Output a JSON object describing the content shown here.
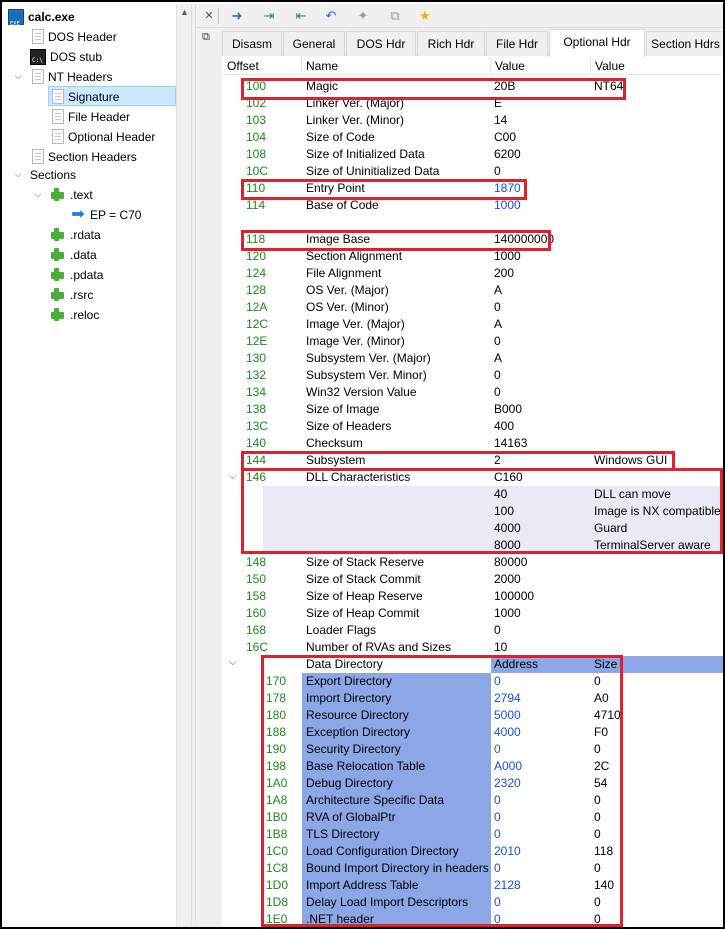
{
  "tree": {
    "root": "calc.exe",
    "items": [
      "DOS Header",
      "DOS stub",
      "NT Headers",
      "Signature",
      "File Header",
      "Optional Header",
      "Section Headers",
      "Sections",
      ".text",
      "EP = C70",
      ".rdata",
      ".data",
      ".pdata",
      ".rsrc",
      ".reloc"
    ]
  },
  "tabs": [
    "Disasm",
    "General",
    "DOS Hdr",
    "Rich Hdr",
    "File Hdr",
    "Optional Hdr",
    "Section Hdrs"
  ],
  "columns": {
    "offset": "Offset",
    "name": "Name",
    "value": "Value",
    "desc": "Value"
  },
  "rows": [
    {
      "off": "100",
      "name": "Magic",
      "val": "20B",
      "desc": "NT64"
    },
    {
      "off": "102",
      "name": "Linker Ver. (Major)",
      "val": "E",
      "desc": ""
    },
    {
      "off": "103",
      "name": "Linker Ver. (Minor)",
      "val": "14",
      "desc": ""
    },
    {
      "off": "104",
      "name": "Size of Code",
      "val": "C00",
      "desc": ""
    },
    {
      "off": "108",
      "name": "Size of Initialized Data",
      "val": "6200",
      "desc": ""
    },
    {
      "off": "10C",
      "name": "Size of Uninitialized Data",
      "val": "0",
      "desc": ""
    },
    {
      "off": "110",
      "name": "Entry Point",
      "val": "1870",
      "desc": ""
    },
    {
      "off": "114",
      "name": "Base of Code",
      "val": "1000",
      "desc": ""
    },
    {
      "off": "",
      "name": "",
      "val": "",
      "desc": ""
    },
    {
      "off": "118",
      "name": "Image Base",
      "val": "140000000",
      "desc": ""
    },
    {
      "off": "120",
      "name": "Section Alignment",
      "val": "1000",
      "desc": ""
    },
    {
      "off": "124",
      "name": "File Alignment",
      "val": "200",
      "desc": ""
    },
    {
      "off": "128",
      "name": "OS Ver. (Major)",
      "val": "A",
      "desc": ""
    },
    {
      "off": "12A",
      "name": "OS Ver. (Minor)",
      "val": "0",
      "desc": ""
    },
    {
      "off": "12C",
      "name": "Image Ver. (Major)",
      "val": "A",
      "desc": ""
    },
    {
      "off": "12E",
      "name": "Image Ver. (Minor)",
      "val": "0",
      "desc": ""
    },
    {
      "off": "130",
      "name": "Subsystem Ver. (Major)",
      "val": "A",
      "desc": ""
    },
    {
      "off": "132",
      "name": "Subsystem Ver. Minor)",
      "val": "0",
      "desc": ""
    },
    {
      "off": "134",
      "name": "Win32 Version Value",
      "val": "0",
      "desc": ""
    },
    {
      "off": "138",
      "name": "Size of Image",
      "val": "B000",
      "desc": ""
    },
    {
      "off": "13C",
      "name": "Size of Headers",
      "val": "400",
      "desc": ""
    },
    {
      "off": "140",
      "name": "Checksum",
      "val": "14163",
      "desc": ""
    },
    {
      "off": "144",
      "name": "Subsystem",
      "val": "2",
      "desc": "Windows GUI"
    },
    {
      "off": "146",
      "name": "DLL Characteristics",
      "val": "C160",
      "desc": ""
    },
    {
      "off": "",
      "name": "",
      "val": "40",
      "desc": "DLL can move"
    },
    {
      "off": "",
      "name": "",
      "val": "100",
      "desc": "Image is NX compatible"
    },
    {
      "off": "",
      "name": "",
      "val": "4000",
      "desc": "Guard"
    },
    {
      "off": "",
      "name": "",
      "val": "8000",
      "desc": "TerminalServer aware"
    },
    {
      "off": "148",
      "name": "Size of Stack Reserve",
      "val": "80000",
      "desc": ""
    },
    {
      "off": "150",
      "name": "Size of Stack Commit",
      "val": "2000",
      "desc": ""
    },
    {
      "off": "158",
      "name": "Size of Heap Reserve",
      "val": "100000",
      "desc": ""
    },
    {
      "off": "160",
      "name": "Size of Heap Commit",
      "val": "1000",
      "desc": ""
    },
    {
      "off": "168",
      "name": "Loader Flags",
      "val": "0",
      "desc": ""
    },
    {
      "off": "16C",
      "name": "Number of RVAs and Sizes",
      "val": "10",
      "desc": ""
    }
  ],
  "data_directory": {
    "title": "Data Directory",
    "col_address": "Address",
    "col_size": "Size",
    "entries": [
      {
        "off": "170",
        "name": "Export Directory",
        "addr": "0",
        "size": "0"
      },
      {
        "off": "178",
        "name": "Import Directory",
        "addr": "2794",
        "size": "A0"
      },
      {
        "off": "180",
        "name": "Resource Directory",
        "addr": "5000",
        "size": "4710"
      },
      {
        "off": "188",
        "name": "Exception Directory",
        "addr": "4000",
        "size": "F0"
      },
      {
        "off": "190",
        "name": "Security Directory",
        "addr": "0",
        "size": "0"
      },
      {
        "off": "198",
        "name": "Base Relocation Table",
        "addr": "A000",
        "size": "2C"
      },
      {
        "off": "1A0",
        "name": "Debug Directory",
        "addr": "2320",
        "size": "54"
      },
      {
        "off": "1A8",
        "name": "Architecture Specific Data",
        "addr": "0",
        "size": "0"
      },
      {
        "off": "1B0",
        "name": "RVA of GlobalPtr",
        "addr": "0",
        "size": "0"
      },
      {
        "off": "1B8",
        "name": "TLS Directory",
        "addr": "0",
        "size": "0"
      },
      {
        "off": "1C0",
        "name": "Load Configuration Directory",
        "addr": "2010",
        "size": "118"
      },
      {
        "off": "1C8",
        "name": "Bound Import Directory in headers",
        "addr": "0",
        "size": "0"
      },
      {
        "off": "1D0",
        "name": "Import Address Table",
        "addr": "2128",
        "size": "140"
      },
      {
        "off": "1D8",
        "name": "Delay Load Import Descriptors",
        "addr": "0",
        "size": "0"
      },
      {
        "off": "1E0",
        "name": ".NET header",
        "addr": "0",
        "size": "0"
      }
    ]
  },
  "colors": {
    "offset_green": "#1d8a1d",
    "link_blue": "#1a4fd8",
    "highlight_red": "#e0202c",
    "dd_blue": "#8da6e6",
    "select_bg": "#cce8ff"
  }
}
